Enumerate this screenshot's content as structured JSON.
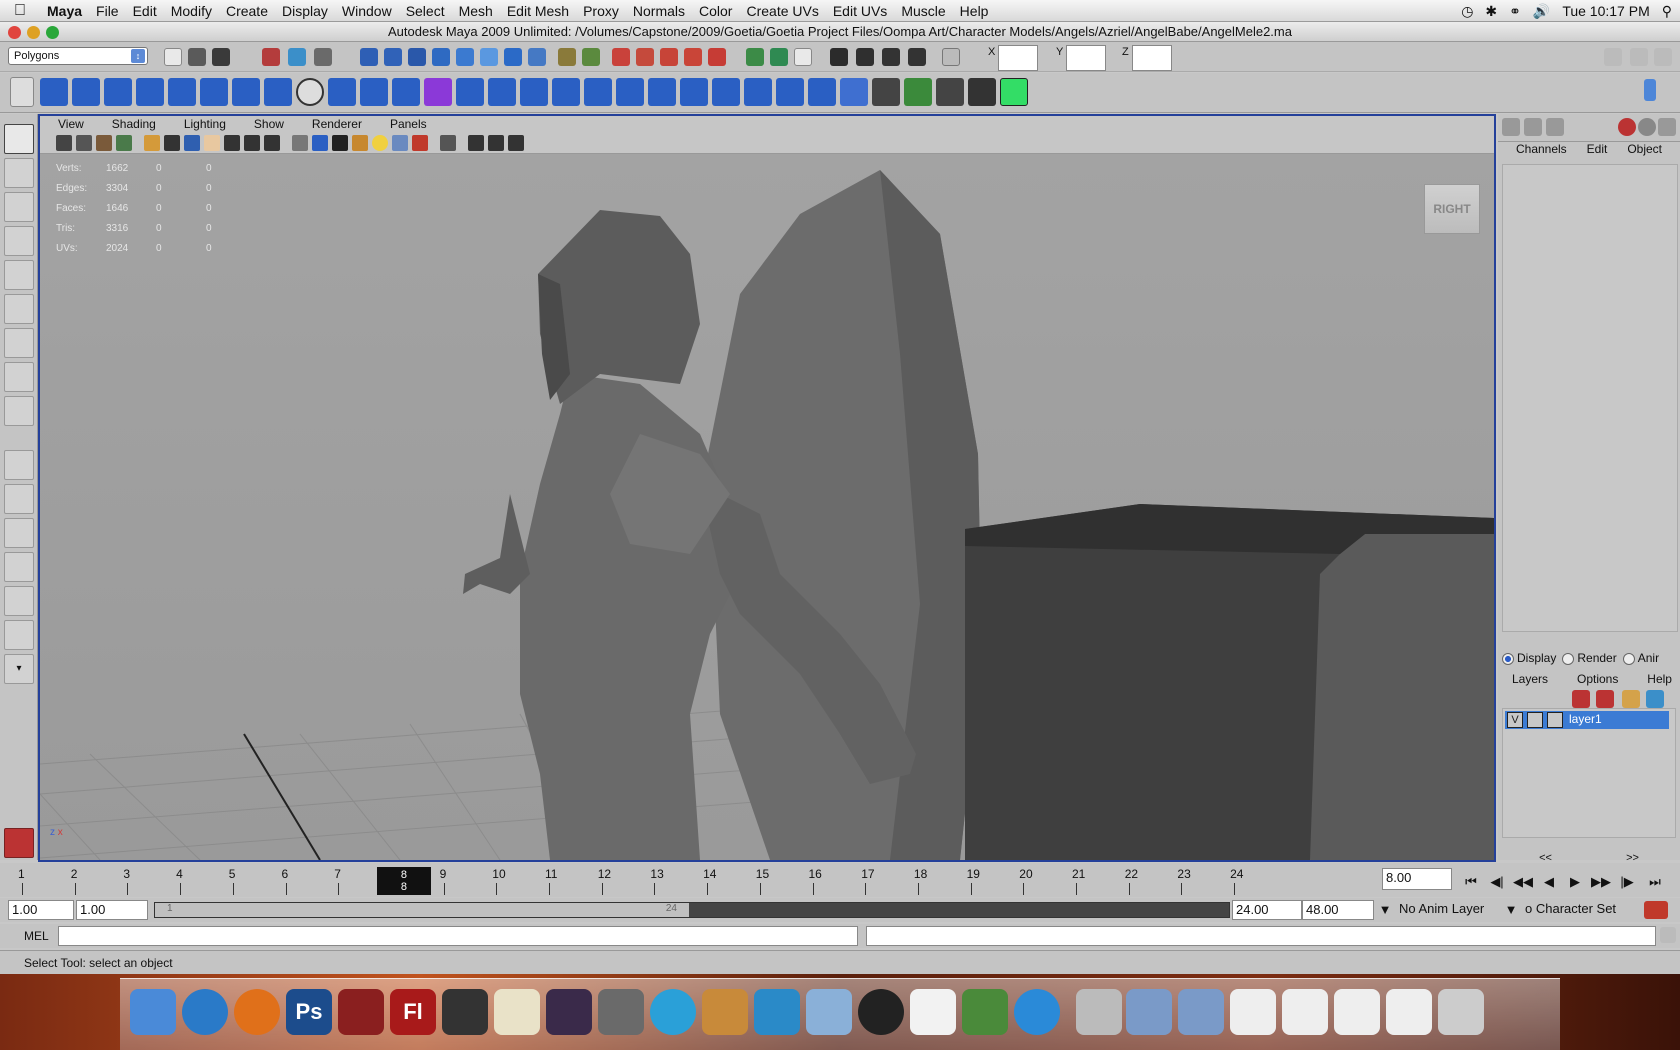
{
  "menubar": {
    "app": "Maya",
    "items": [
      "File",
      "Edit",
      "Modify",
      "Create",
      "Display",
      "Window",
      "Select",
      "Mesh",
      "Edit Mesh",
      "Proxy",
      "Normals",
      "Color",
      "Create UVs",
      "Edit UVs",
      "Muscle",
      "Help"
    ],
    "clock": "Tue 10:17 PM"
  },
  "window": {
    "title": "Autodesk Maya 2009 Unlimited: /Volumes/Capstone/2009/Goetia/Goetia Project Files/Oompa Art/Character Models/Angels/Azriel/AngelBabe/AngelMele2.ma"
  },
  "statusline": {
    "menuset": "Polygons",
    "x_label": "X",
    "y_label": "Y",
    "z_label": "Z",
    "x_value": "",
    "y_value": "",
    "z_value": ""
  },
  "panel": {
    "menus": [
      "View",
      "Shading",
      "Lighting",
      "Show",
      "Renderer",
      "Panels"
    ],
    "viewcube": "RIGHT",
    "axis_x": "x",
    "axis_z": "z",
    "hud": [
      {
        "label": "Verts:",
        "a": "1662",
        "b": "0",
        "c": "0"
      },
      {
        "label": "Edges:",
        "a": "3304",
        "b": "0",
        "c": "0"
      },
      {
        "label": "Faces:",
        "a": "1646",
        "b": "0",
        "c": "0"
      },
      {
        "label": "Tris:",
        "a": "3316",
        "b": "0",
        "c": "0"
      },
      {
        "label": "UVs:",
        "a": "2024",
        "b": "0",
        "c": "0"
      }
    ]
  },
  "channelbox": {
    "tabs": [
      "Channels",
      "Edit",
      "Object"
    ]
  },
  "layers": {
    "modes": [
      "Display",
      "Render",
      "Anir"
    ],
    "menu": [
      "Layers",
      "Options",
      "Help"
    ],
    "visible_flag": "V",
    "layer_name": "layer1",
    "scroll_left": "<<",
    "scroll_right": ">>"
  },
  "timeslider": {
    "frames": [
      "1",
      "2",
      "3",
      "4",
      "5",
      "6",
      "7",
      "8",
      "9",
      "10",
      "11",
      "12",
      "13",
      "14",
      "15",
      "16",
      "17",
      "18",
      "19",
      "20",
      "21",
      "22",
      "23",
      "24"
    ],
    "current_frame": "8",
    "current_time": "8.00"
  },
  "rangeslider": {
    "start_time": "1.00",
    "playback_start": "1.00",
    "range_start_marker": "1",
    "range_end_marker": "24",
    "playback_end": "24.00",
    "end_time": "48.00",
    "anim_layer": "No Anim Layer",
    "character_set": "o Character Set"
  },
  "cmdline": {
    "label": "MEL"
  },
  "helpline": {
    "text": "Select Tool: select an object"
  },
  "dock": {
    "photoshop": "Ps",
    "flash": "Fl"
  }
}
